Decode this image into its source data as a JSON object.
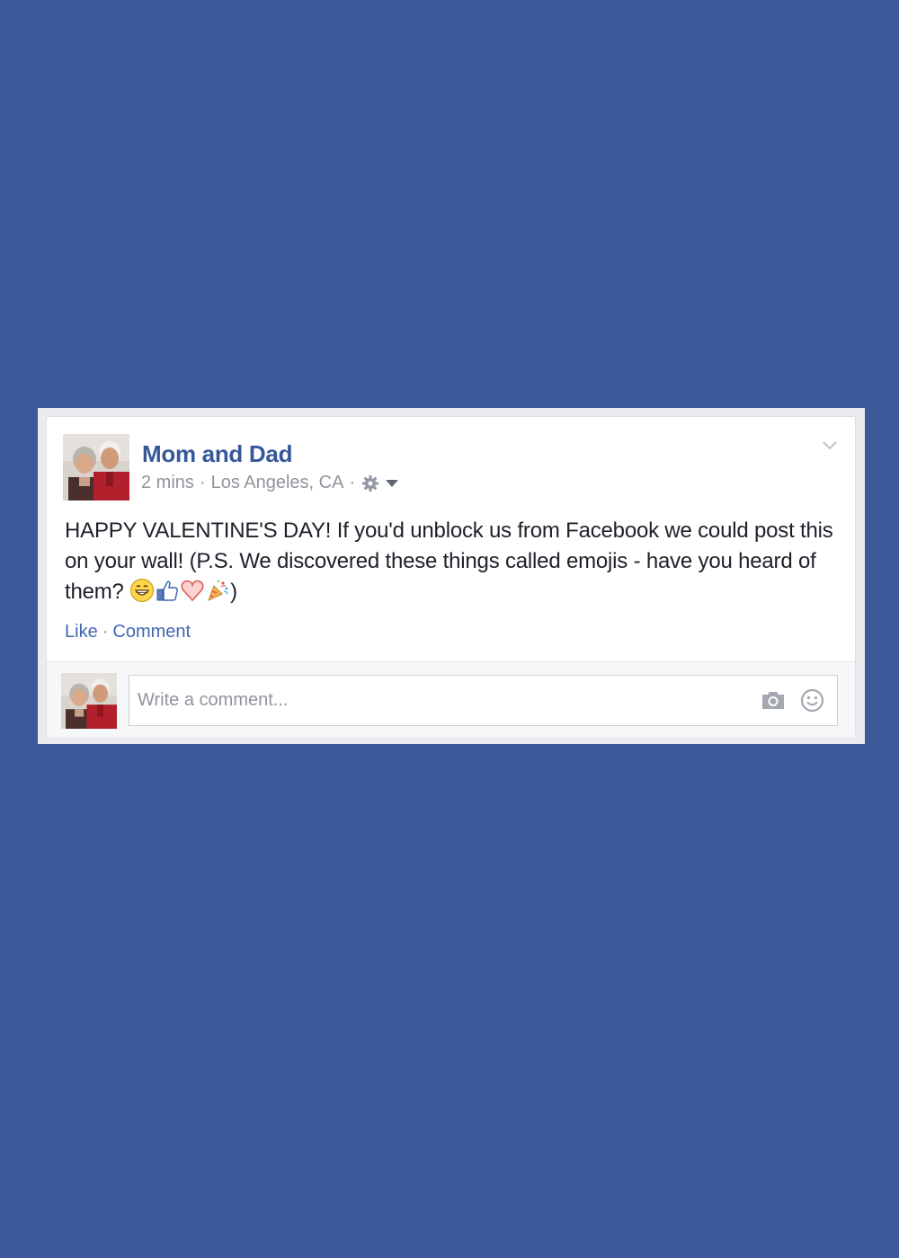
{
  "post": {
    "author": "Mom and Dad",
    "time": "2 mins",
    "location": "Los Angeles, CA",
    "separator": "·",
    "privacy_icon": "gear-icon",
    "text_main": "HAPPY VALENTINE'S DAY! If you'd unblock us from Facebook we could post this on your wall! (P.S. We discovered these things called emojis - have you heard of them? ",
    "text_close": ")",
    "emojis": [
      "grinning-face-emoji",
      "thumbs-up-emoji",
      "heart-emoji",
      "party-popper-emoji"
    ]
  },
  "actions": {
    "like_label": "Like",
    "separator": "·",
    "comment_label": "Comment"
  },
  "comment_box": {
    "placeholder": "Write a comment...",
    "value": "",
    "icons": [
      "camera-icon",
      "smiley-icon"
    ]
  },
  "colors": {
    "page_background": "#3c5a99",
    "author_name": "#365899",
    "link": "#4267b2",
    "meta_text": "#90949c",
    "body_text": "#1d2129"
  }
}
